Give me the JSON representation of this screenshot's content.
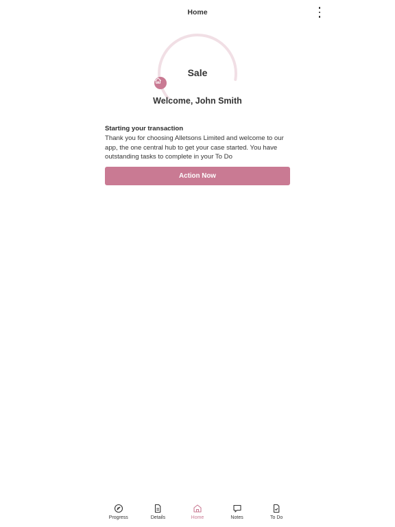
{
  "header": {
    "title": "Home"
  },
  "progress": {
    "label": "Sale",
    "fraction": 0.72
  },
  "welcome": {
    "text": "Welcome, John Smith"
  },
  "transaction": {
    "title": "Starting your transaction",
    "body": "Thank you for choosing Alletsons Limited and welcome to our app, the one central hub to get your case started. You have outstanding tasks to complete in your To Do"
  },
  "action": {
    "label": "Action Now"
  },
  "nav": {
    "items": [
      {
        "label": "Progress",
        "icon": "compass-icon"
      },
      {
        "label": "Details",
        "icon": "document-icon"
      },
      {
        "label": "Home",
        "icon": "home-icon"
      },
      {
        "label": "Notes",
        "icon": "chat-icon"
      },
      {
        "label": "To Do",
        "icon": "document-check-icon"
      }
    ],
    "active": "Home"
  },
  "colors": {
    "accent": "#c97a93",
    "ring_track": "#f1dfe5",
    "text": "#333333"
  }
}
